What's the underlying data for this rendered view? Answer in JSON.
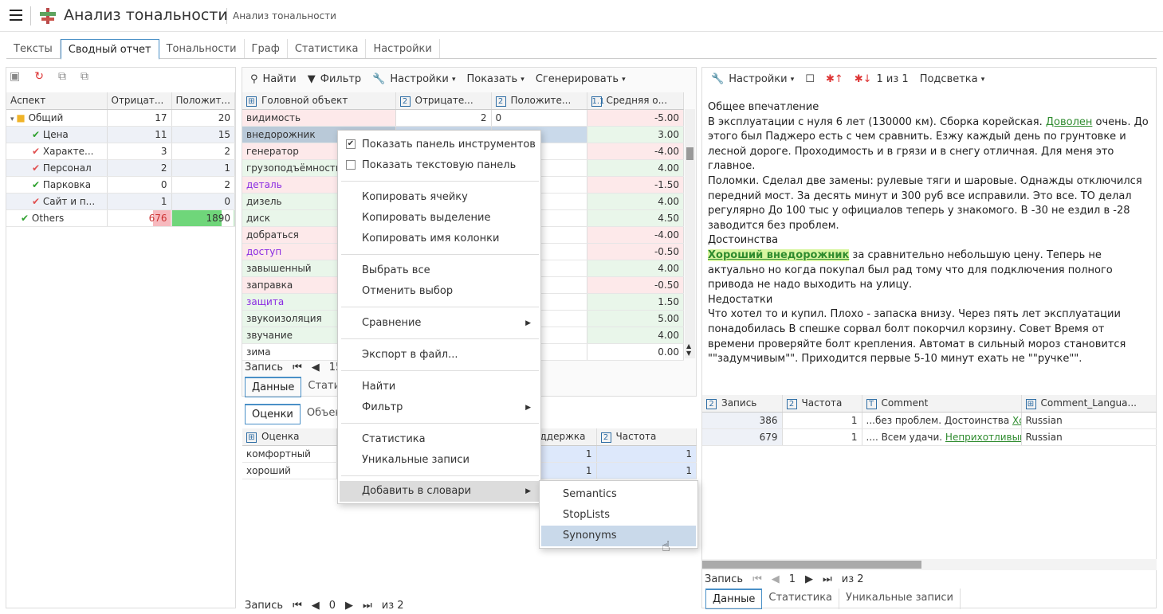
{
  "app": {
    "title": "Анализ тональности",
    "subtitle": "Анализ тональности"
  },
  "tabs": [
    "Тексты",
    "Сводный отчет",
    "Тональности",
    "Граф",
    "Статистика",
    "Настройки"
  ],
  "left": {
    "headers": [
      "Аспект",
      "Отрицат...",
      "Положит..."
    ],
    "rows": [
      {
        "label": "Общий",
        "neg": "17",
        "pos": "20",
        "icon": "folder-icon"
      },
      {
        "label": "Цена",
        "neg": "11",
        "pos": "15",
        "icon": "check-icon"
      },
      {
        "label": "Характе...",
        "neg": "3",
        "pos": "2",
        "icon": "cross-check-icon"
      },
      {
        "label": "Персонал",
        "neg": "2",
        "pos": "1",
        "icon": "cross-check-icon"
      },
      {
        "label": "Парковка",
        "neg": "0",
        "pos": "2",
        "icon": "check-icon"
      },
      {
        "label": "Сайт и п...",
        "neg": "1",
        "pos": "0",
        "icon": "cross-check-icon"
      },
      {
        "label": "Others",
        "neg": "676",
        "pos": "1890",
        "icon": "check-icon"
      }
    ]
  },
  "mid": {
    "toolbar": {
      "find": "Найти",
      "filter": "Фильтр",
      "settings": "Настройки",
      "show": "Показать",
      "generate": "Сгенерировать"
    },
    "headers": [
      "Головной объект",
      "Отрицате...",
      "Положите...",
      "Средняя о..."
    ],
    "rows": [
      {
        "obj": "видимость",
        "neg": "2",
        "pos": "0",
        "avg": "-5.00"
      },
      {
        "obj": "внедорожник",
        "neg": "",
        "pos": "",
        "avg": "3.00"
      },
      {
        "obj": "генератор",
        "neg": "",
        "pos": "",
        "avg": "-4.00"
      },
      {
        "obj": "грузоподъёмность",
        "neg": "",
        "pos": "",
        "avg": "4.00"
      },
      {
        "obj": "деталь",
        "neg": "",
        "pos": "",
        "avg": "-1.50"
      },
      {
        "obj": "дизель",
        "neg": "",
        "pos": "",
        "avg": "4.00"
      },
      {
        "obj": "диск",
        "neg": "",
        "pos": "",
        "avg": "4.50"
      },
      {
        "obj": "добраться",
        "neg": "",
        "pos": "",
        "avg": "-4.00"
      },
      {
        "obj": "доступ",
        "neg": "",
        "pos": "",
        "avg": "-0.50"
      },
      {
        "obj": "завышенный",
        "neg": "",
        "pos": "",
        "avg": "4.00"
      },
      {
        "obj": "заправка",
        "neg": "",
        "pos": "",
        "avg": "-0.50"
      },
      {
        "obj": "защита",
        "neg": "",
        "pos": "",
        "avg": "1.50"
      },
      {
        "obj": "звукоизоляция",
        "neg": "",
        "pos": "",
        "avg": "5.00"
      },
      {
        "obj": "звучание",
        "neg": "",
        "pos": "",
        "avg": "4.00"
      },
      {
        "obj": "зима",
        "neg": "",
        "pos": "",
        "avg": "0.00"
      }
    ],
    "record_label": "Запись",
    "record_num": "15",
    "subtabs": [
      "Данные",
      "Статис"
    ],
    "lowertabs": [
      "Оценки",
      "Объект"
    ],
    "lower_headers": [
      "Оценка",
      "ддержка",
      "Частота"
    ],
    "lower_rows": [
      {
        "name": "комфортный",
        "sup": "1",
        "freq": "1"
      },
      {
        "name": "хороший",
        "sup": "1",
        "freq": "1"
      }
    ],
    "footer": {
      "label": "Запись",
      "current": "0",
      "of": "из 2"
    }
  },
  "menu": {
    "items": [
      "Показать панель инструментов",
      "Показать текстовую панель",
      "Копировать ячейку",
      "Копировать выделение",
      "Копировать имя колонки",
      "Выбрать все",
      "Отменить выбор",
      "Сравнение",
      "Экспорт в файл...",
      "Найти",
      "Фильтр",
      "Статистика",
      "Уникальные записи",
      "Добавить в словари"
    ],
    "submenu": [
      "Semantics",
      "StopLists",
      "Synonyms"
    ]
  },
  "right": {
    "toolbar": {
      "settings": "Настройки",
      "counter": "1 из 1",
      "highlight": "Подсветка"
    },
    "text": {
      "p1": "Общее впечатление",
      "p2a": "В эксплуатации с нуля 6 лет (130000 км). Сборка корейская. ",
      "p2link": "Доволен",
      "p2b": " очень. До этого был Паджеро есть с чем сравнить. Езжу каждый день по грунтовке и лесной дороге. Проходимость и в грязи и в снегу отличная. Для меня это главное.",
      "p3": "Поломки. Сделал две замены: рулевые тяги и шаровые. Однажды отключился передний мост. За десять минут и 300 руб все исправили. Это все. ТО делал регулярно До 100 тыс у официалов теперь у знакомого. В -30 не ездил в -28 заводится без проблем.",
      "p4": "Достоинства",
      "p5hl": "Хороший внедорожник",
      "p5b": " за сравнительно небольшую цену. Теперь не актуально но когда покупал был рад тому что для подключения полного привода не надо выходить на улицу.",
      "p6": "Недостатки",
      "p7": "Что хотел то и купил. Плохо - запаска внизу. Через пять лет эксплуатации понадобилась В спешке сорвал болт покорчил корзину. Совет Время от времени проверяйте болт крепления. Автомат в сильный мороз становится \"\"задумчивым\"\". Приходится первые 5-10 минут ехать не \"\"ручке\"\"."
    },
    "headers": [
      "Запись",
      "Частота",
      "Comment",
      "Comment_Langua..."
    ],
    "rows": [
      {
        "rec": "386",
        "freq": "1",
        "comment": "...без проблем. Достоинства ",
        "link": "Хор",
        "lang": "Russian"
      },
      {
        "rec": "679",
        "freq": "1",
        "comment": ".... Всем удачи. ",
        "link": "Неприхотливый к",
        "lang": "Russian"
      }
    ],
    "footer": {
      "label": "Запись",
      "current": "1",
      "of": "из 2"
    },
    "tabs": [
      "Данные",
      "Статистика",
      "Уникальные записи"
    ]
  },
  "colors": {
    "accent": "#4a90c7",
    "neg": "#fde9ea",
    "pos": "#e9f6ea",
    "selected": "#c9d9ea"
  }
}
